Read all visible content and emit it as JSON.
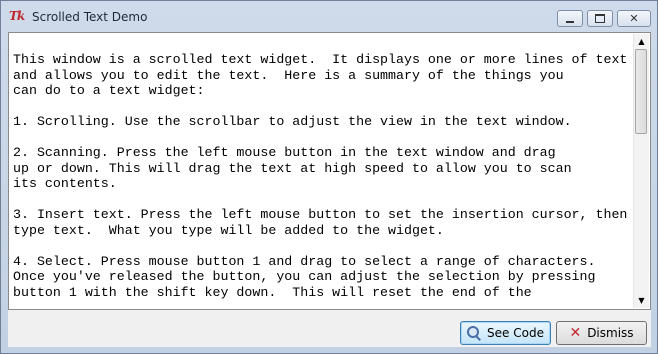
{
  "window": {
    "title": "Scrolled Text Demo",
    "icon_text": "Tk",
    "controls": {
      "minimize": "minimize",
      "maximize": "maximize",
      "close": "✕"
    }
  },
  "text": {
    "lines": [
      "This window is a scrolled text widget.  It displays one or more lines of text",
      "and allows you to edit the text.  Here is a summary of the things you",
      "can do to a text widget:",
      "",
      "1. Scrolling. Use the scrollbar to adjust the view in the text window.",
      "",
      "2. Scanning. Press the left mouse button in the text window and drag",
      "up or down. This will drag the text at high speed to allow you to scan",
      "its contents.",
      "",
      "3. Insert text. Press the left mouse button to set the insertion cursor, then",
      "type text.  What you type will be added to the widget.",
      "",
      "4. Select. Press mouse button 1 and drag to select a range of characters.",
      "Once you've released the button, you can adjust the selection by pressing",
      "button 1 with the shift key down.  This will reset the end of the"
    ]
  },
  "scrollbar": {
    "up_glyph": "▲",
    "down_glyph": "▼",
    "position_fraction": 0.0
  },
  "buttons": {
    "see_code": "See Code",
    "dismiss": "Dismiss"
  }
}
